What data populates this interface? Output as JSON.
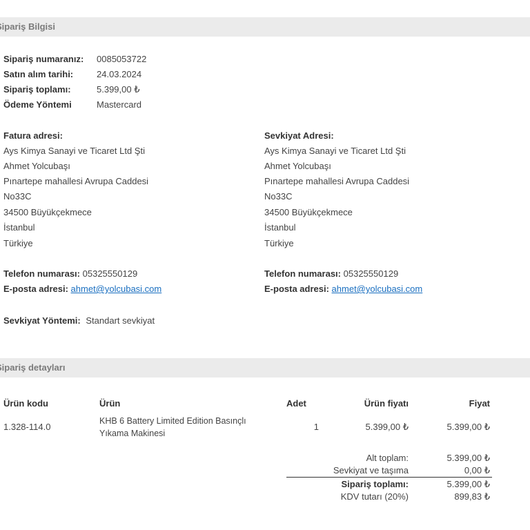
{
  "order_info": {
    "heading": "Sipariş Bilgisi",
    "number_label": "Sipariş numaranız:",
    "number_value": "0085053722",
    "date_label": "Satın alım tarihi:",
    "date_value": "24.03.2024",
    "total_label": "Sipariş toplamı:",
    "total_value": "5.399,00 ₺",
    "payment_label": "Ödeme Yöntemi",
    "payment_value": "Mastercard"
  },
  "billing": {
    "title": "Fatura adresi:",
    "lines": [
      "Ays Kimya Sanayi ve Ticaret Ltd Şti",
      "Ahmet Yolcubaşı",
      "Pınartepe mahallesi Avrupa Caddesi",
      "No33C",
      "34500 Büyükçekmece",
      "İstanbul",
      "Türkiye"
    ],
    "phone_label": "Telefon numarası:",
    "phone_value": "05325550129",
    "email_label": "E-posta adresi:",
    "email_value": "ahmet@yolcubasi.com"
  },
  "shipping": {
    "title": "Sevkiyat Adresi:",
    "lines": [
      "Ays Kimya Sanayi ve Ticaret Ltd Şti",
      "Ahmet Yolcubaşı",
      "Pınartepe mahallesi Avrupa Caddesi",
      "No33C",
      "34500 Büyükçekmece",
      "İstanbul",
      "Türkiye"
    ],
    "phone_label": "Telefon numarası:",
    "phone_value": "05325550129",
    "email_label": "E-posta adresi:",
    "email_value": "ahmet@yolcubasi.com",
    "method_label": "Sevkiyat Yöntemi:",
    "method_value": "Standart sevkiyat"
  },
  "details": {
    "heading": "Sipariş detayları",
    "columns": {
      "code": "Ürün kodu",
      "product": "Ürün",
      "qty": "Adet",
      "unit_price": "Ürün fiyatı",
      "price": "Fiyat"
    },
    "items": [
      {
        "code": "1.328-114.0",
        "product_line1": "KHB 6 Battery Limited Edition Basınçlı",
        "product_line2": "Yıkama Makinesi",
        "qty": "1",
        "unit_price": "5.399,00 ₺",
        "price": "5.399,00 ₺"
      }
    ],
    "totals": {
      "subtotal_label": "Alt toplam:",
      "subtotal_value": "5.399,00 ₺",
      "shipping_label": "Sevkiyat ve taşıma",
      "shipping_value": "0,00 ₺",
      "order_total_label": "Sipariş toplamı:",
      "order_total_value": "5.399,00 ₺",
      "vat_label": "KDV tutarı (20%)",
      "vat_value": "899,83 ₺"
    }
  }
}
